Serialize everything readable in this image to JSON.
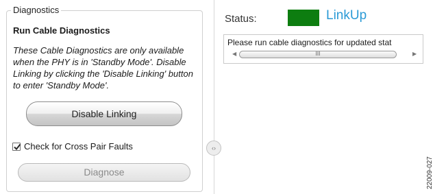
{
  "diagnostics_panel": {
    "group_label": "Diagnostics",
    "section_title": "Run Cable Diagnostics",
    "description": "These Cable Diagnostics are only available when the PHY is in 'Standby Mode'. Disable Linking by clicking the 'Disable Linking' button to enter 'Standby Mode'.",
    "disable_linking_label": "Disable Linking",
    "cross_pair_checkbox": {
      "label": "Check for Cross Pair Faults",
      "checked": true
    },
    "diagnose_label": "Diagnose",
    "diagnose_enabled": false
  },
  "splitter": {
    "icon": "collapse-expand-icon",
    "glyph": "‹›"
  },
  "status": {
    "label": "Status:",
    "value": "LinkUp",
    "indicator_color": "#0D7D10",
    "value_color": "#2A9AD6"
  },
  "output": {
    "text": "Please run cable diagnostics for updated stat",
    "scrollbar": {
      "left_arrow": "◀",
      "right_arrow": "▶",
      "thumb_grip": "III"
    }
  },
  "figure_id": "22009-027"
}
